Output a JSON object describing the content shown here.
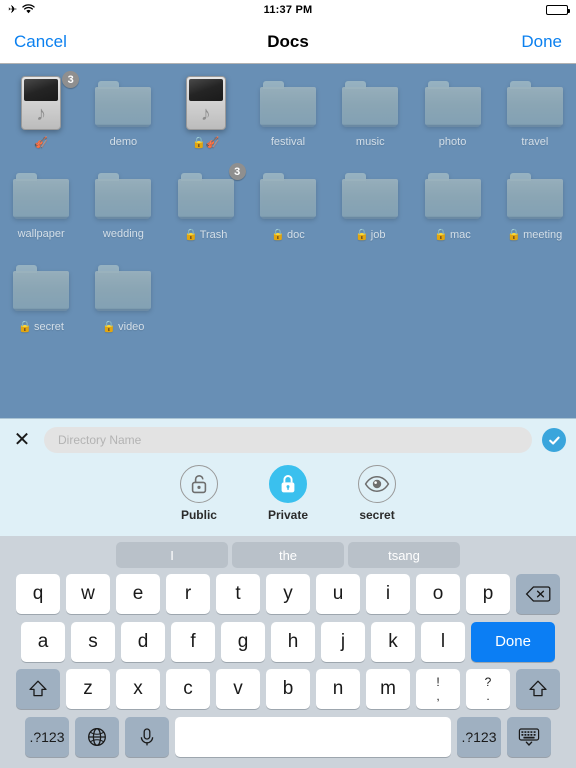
{
  "statusbar": {
    "airplane_icon": "airplane-mode-icon",
    "wifi_icon": "wifi-icon",
    "time": "11:37 PM",
    "battery_icon": "battery-icon"
  },
  "navbar": {
    "cancel_label": "Cancel",
    "title": "Docs",
    "done_label": "Done"
  },
  "files": {
    "background_color": "#688fb5",
    "items": [
      {
        "label": "",
        "lock": "🎻",
        "type": "ipod",
        "badge": "3"
      },
      {
        "label": "demo",
        "lock": "",
        "type": "folder",
        "badge": ""
      },
      {
        "label": "",
        "lock": "🔒🎻",
        "type": "ipod",
        "badge": ""
      },
      {
        "label": "festival",
        "lock": "",
        "type": "folder",
        "badge": ""
      },
      {
        "label": "music",
        "lock": "",
        "type": "folder",
        "badge": ""
      },
      {
        "label": "photo",
        "lock": "",
        "type": "folder",
        "badge": ""
      },
      {
        "label": "travel",
        "lock": "",
        "type": "folder",
        "badge": ""
      },
      {
        "label": "wallpaper",
        "lock": "",
        "type": "folder",
        "badge": ""
      },
      {
        "label": "wedding",
        "lock": "",
        "type": "folder",
        "badge": ""
      },
      {
        "label": "Trash",
        "lock": "🔒",
        "type": "folder",
        "badge": "3"
      },
      {
        "label": "doc",
        "lock": "🔒",
        "type": "folder",
        "badge": ""
      },
      {
        "label": "job",
        "lock": "🔒",
        "type": "folder",
        "badge": ""
      },
      {
        "label": "mac",
        "lock": "🔒",
        "type": "folder",
        "badge": ""
      },
      {
        "label": "meeting",
        "lock": "🔒",
        "type": "folder",
        "badge": ""
      },
      {
        "label": "secret",
        "lock": "🔒",
        "type": "folder",
        "badge": ""
      },
      {
        "label": "video",
        "lock": "🔒",
        "type": "folder",
        "badge": ""
      }
    ]
  },
  "input_panel": {
    "close_icon": "close-x-icon",
    "field_value": "",
    "field_placeholder": "Directory Name",
    "confirm_icon": "checkmark-circle-icon",
    "accent_color": "#3aa5dc",
    "options": [
      {
        "label": "Public",
        "icon": "unlocked-padlock-icon",
        "selected": false
      },
      {
        "label": "Private",
        "icon": "locked-padlock-icon",
        "selected": true
      },
      {
        "label": "secret",
        "icon": "eye-icon",
        "selected": false
      }
    ]
  },
  "keyboard": {
    "suggestions": [
      "I",
      "the",
      "tsang"
    ],
    "row1": [
      "q",
      "w",
      "e",
      "r",
      "t",
      "y",
      "u",
      "i",
      "o",
      "p"
    ],
    "backspace_icon": "backspace-icon",
    "row2": [
      "a",
      "s",
      "d",
      "f",
      "g",
      "h",
      "j",
      "k",
      "l"
    ],
    "return_label": "Done",
    "shift_icon": "shift-arrow-icon",
    "row3": [
      "z",
      "x",
      "c",
      "v",
      "b",
      "n",
      "m"
    ],
    "punct1_top": "!",
    "punct1_bottom": ",",
    "punct2_top": "?",
    "punct2_bottom": ".",
    "numeric_label": "123",
    "numeric_label_full": ".?123",
    "globe_icon": "globe-icon",
    "mic_icon": "microphone-icon",
    "space_label": "",
    "dismiss_icon": "dismiss-keyboard-icon"
  }
}
